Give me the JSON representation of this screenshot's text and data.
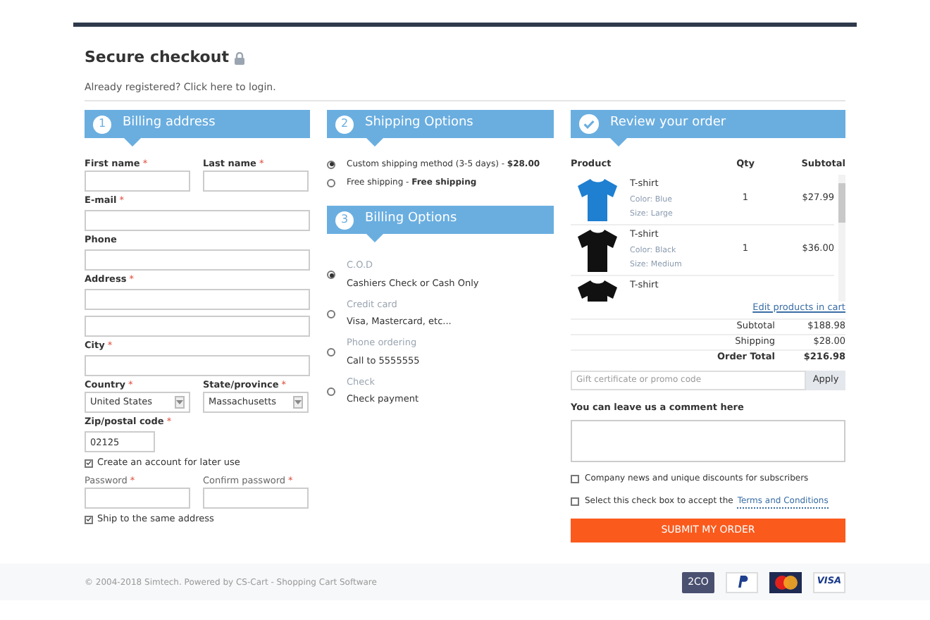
{
  "header": {
    "title": "Secure checkout",
    "login_text": "Already registered? Click here to login."
  },
  "billing_address": {
    "number": "1",
    "title": "Billing address",
    "rows": [
      {
        "kind": "pair",
        "fields": [
          {
            "label": "First name",
            "marker": "*"
          },
          {
            "label": "Last name",
            "marker": "*"
          }
        ]
      },
      {
        "kind": "single",
        "fields": [
          {
            "label": "E-mail",
            "marker": "*"
          }
        ]
      },
      {
        "kind": "single",
        "fields": [
          {
            "label": "Phone"
          }
        ]
      },
      {
        "kind": "double",
        "fields": [
          {
            "label": "Address",
            "marker": "*"
          }
        ]
      },
      {
        "kind": "single",
        "fields": [
          {
            "label": "City",
            "marker": "*"
          }
        ]
      },
      {
        "kind": "selects",
        "fields": [
          {
            "label": "Country",
            "marker": "*",
            "value": "United States"
          },
          {
            "label": "State/province",
            "marker": "*",
            "value": "Massachusetts"
          }
        ]
      },
      {
        "kind": "short",
        "fields": [
          {
            "label": "Zip/postal code",
            "marker": "*",
            "value": "02125"
          }
        ]
      },
      {
        "kind": "checkbox",
        "label": "Create an account for later use",
        "checked": true
      },
      {
        "kind": "password",
        "fields": [
          {
            "label": "Password",
            "marker": "*"
          },
          {
            "label": "Confirm password",
            "marker": "*"
          }
        ]
      },
      {
        "kind": "checkbox",
        "label": "Ship to the same address",
        "checked": true
      }
    ]
  },
  "shipping_options": {
    "number": "2",
    "title": "Shipping Options",
    "options": [
      {
        "text": "Custom shipping method (3-5 days) - **$28.00**",
        "selected": true
      },
      {
        "text": "Free shipping - **Free shipping**",
        "selected": false
      }
    ]
  },
  "billing_options": {
    "number": "3",
    "title": "Billing Options",
    "options": [
      {
        "name": "C.O.D",
        "description": "Cashiers Check or Cash Only",
        "selected": true
      },
      {
        "name": "Credit card",
        "description": "Visa, Mastercard, etc...",
        "selected": false
      },
      {
        "name": "Phone ordering",
        "description": "Call to 5555555",
        "selected": false
      },
      {
        "name": "Check",
        "description": "Check payment",
        "selected": false
      }
    ]
  },
  "review": {
    "title": "Review your order",
    "columns": [
      "Product",
      "Qty",
      "Subtotal"
    ],
    "products": [
      {
        "name": "T-shirt",
        "color": "#1f7fd0",
        "details": [
          "Color: Blue",
          "Size: Large"
        ],
        "qty": "1",
        "subtotal": "$27.99"
      },
      {
        "name": "T-shirt",
        "color": "#111111",
        "details": [
          "Color: Black",
          "Size: Medium"
        ],
        "qty": "1",
        "subtotal": "$36.00"
      },
      {
        "name": "T-shirt",
        "color": "#111111"
      }
    ],
    "edit_link": "Edit products in cart",
    "totals": [
      {
        "label": "Subtotal",
        "value": "$188.98",
        "kind": "normal"
      },
      {
        "label": "Shipping",
        "value": "$28.00",
        "kind": "normal"
      },
      {
        "label": "Order Total",
        "value": "$216.98",
        "kind": "total"
      }
    ],
    "promo_placeholder": "Gift certificate or promo code",
    "apply_button": "Apply",
    "comment_label": "You can leave us a comment here",
    "checkboxes": [
      {
        "text": "Company news and unique discounts for subscribers",
        "checked": false
      },
      {
        "text": "Select this check box to accept the",
        "link": "Terms and Conditions",
        "checked": false
      }
    ],
    "submit_button": "SUBMIT MY ORDER"
  },
  "footer": {
    "copyright": "© 2004-2018 Simtech.  Powered by CS-Cart - Shopping Cart Software",
    "payment_badges": [
      {
        "kind": "checkout",
        "text": "2CO"
      },
      {
        "kind": "paypal"
      },
      {
        "kind": "mastercard"
      },
      {
        "kind": "visa",
        "text": "VISA"
      }
    ]
  }
}
